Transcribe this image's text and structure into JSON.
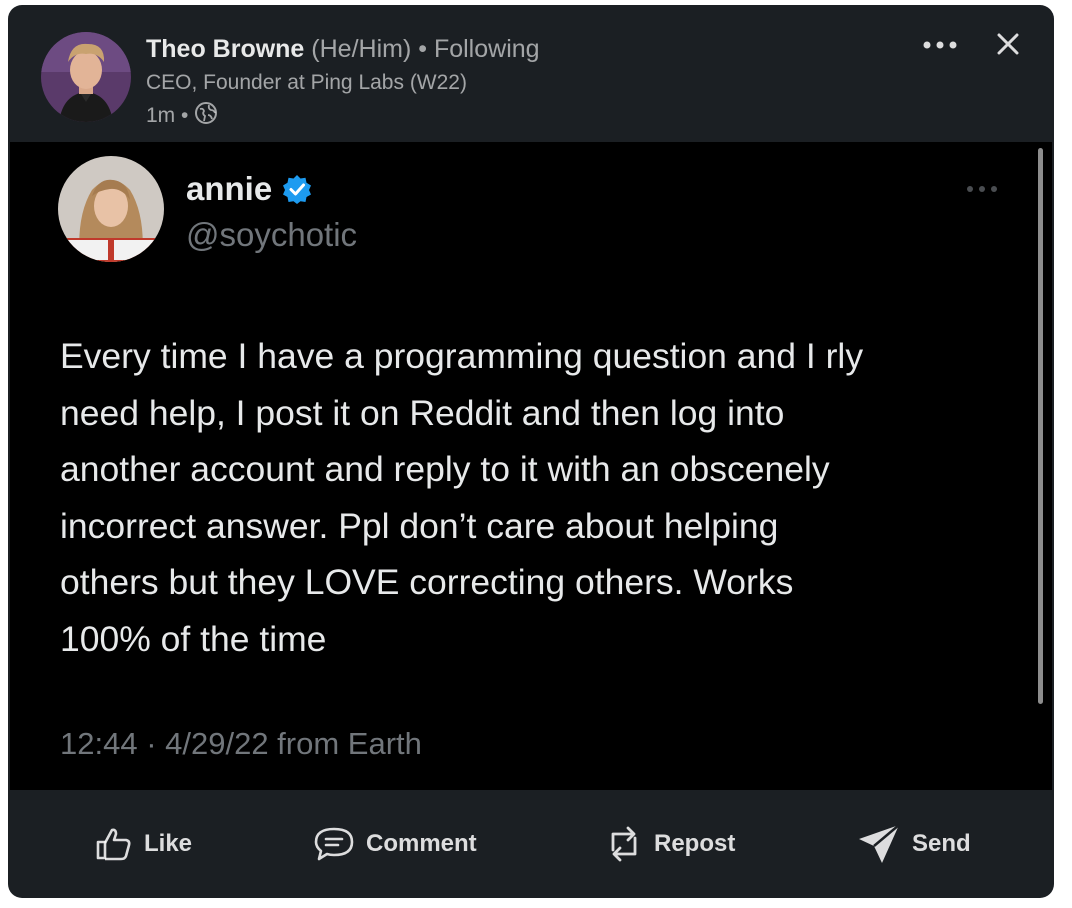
{
  "post": {
    "author_name": "Theo Browne",
    "author_pronouns": "(He/Him)",
    "author_relation": "• Following",
    "author_title": "CEO, Founder at Ping Labs (W22)",
    "post_age": "1m •",
    "visibility_icon": "globe-icon"
  },
  "window_controls": {
    "more_icon": "more-horizontal-icon",
    "close_icon": "close-icon"
  },
  "tweet": {
    "name": "annie",
    "handle": "@soychotic",
    "verified_icon": "verified-badge-icon",
    "text_lines": [
      "Every time I have a programming question and I rly",
      "need help, I post it on Reddit and then log into",
      "another account and reply to it with an obscenely",
      "incorrect answer. Ppl don’t care about helping",
      "others but they LOVE correcting others. Works",
      "100% of the time"
    ],
    "footer": "12:44 · 4/29/22 from Earth"
  },
  "actions": [
    {
      "label": "Like",
      "icon": "thumbs-up-icon"
    },
    {
      "label": "Comment",
      "icon": "comment-icon"
    },
    {
      "label": "Repost",
      "icon": "repost-icon"
    },
    {
      "label": "Send",
      "icon": "send-icon"
    }
  ],
  "colors": {
    "card_background": "#1b1f23",
    "tweet_background": "#000000",
    "verified_blue": "#1d9bf0"
  }
}
